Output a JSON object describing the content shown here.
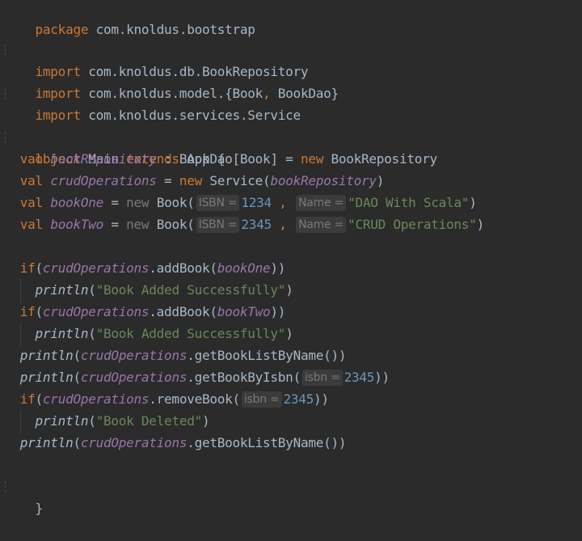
{
  "colors": {
    "background": "#2b2b2b",
    "keyword": "#cc7832",
    "variable": "#9876aa",
    "string": "#6a8759",
    "number": "#6897bb",
    "text": "#a9b7c6",
    "hint_bg": "#3b3b3b"
  },
  "code": {
    "pkg_kw": "package",
    "pkg_name": " com.knoldus.bootstrap",
    "imp_kw": "import",
    "imp1": " com.knoldus.db.BookRepository",
    "imp2a": " com.knoldus.model.{Book",
    "imp2comma": ",",
    "imp2b": " BookDao}",
    "imp3": " com.knoldus.services.Service",
    "obj_kw": "object",
    "obj_name": " Main ",
    "extends_kw": "extends",
    "obj_rest": " App {",
    "val_kw": "val",
    "bookRepository": "bookRepository",
    "line1_rest": " : BookDao[Book] = ",
    "new_kw": "new",
    "BookRepository": " BookRepository",
    "crudOperations": "crudOperations",
    "eq": " = ",
    "Service_open": " Service(",
    "close_paren": ")",
    "bookOne": "bookOne",
    "bookTwo": "bookTwo",
    "Book_open": " Book(",
    "hint_isbn": "ISBN =",
    "hint_name": "Name =",
    "hint_isbn_lc": "isbn =",
    "num_1234": "1234",
    "num_2345": "2345",
    "comma_sep": " , ",
    "str_dao": "\"DAO With Scala\"",
    "str_crud": "\"CRUD Operations\"",
    "if_kw": "if",
    "open_paren": "(",
    "addBook_open": ".addBook(",
    "close_two": "))",
    "println": "println",
    "str_added": "\"Book Added Successfully\"",
    "getBookListByName": ".getBookListByName())",
    "getBookByIsbn_open": ".getBookByIsbn(",
    "removeBook_open": ".removeBook(",
    "str_deleted": "\"Book Deleted\"",
    "close_brace": "}"
  }
}
